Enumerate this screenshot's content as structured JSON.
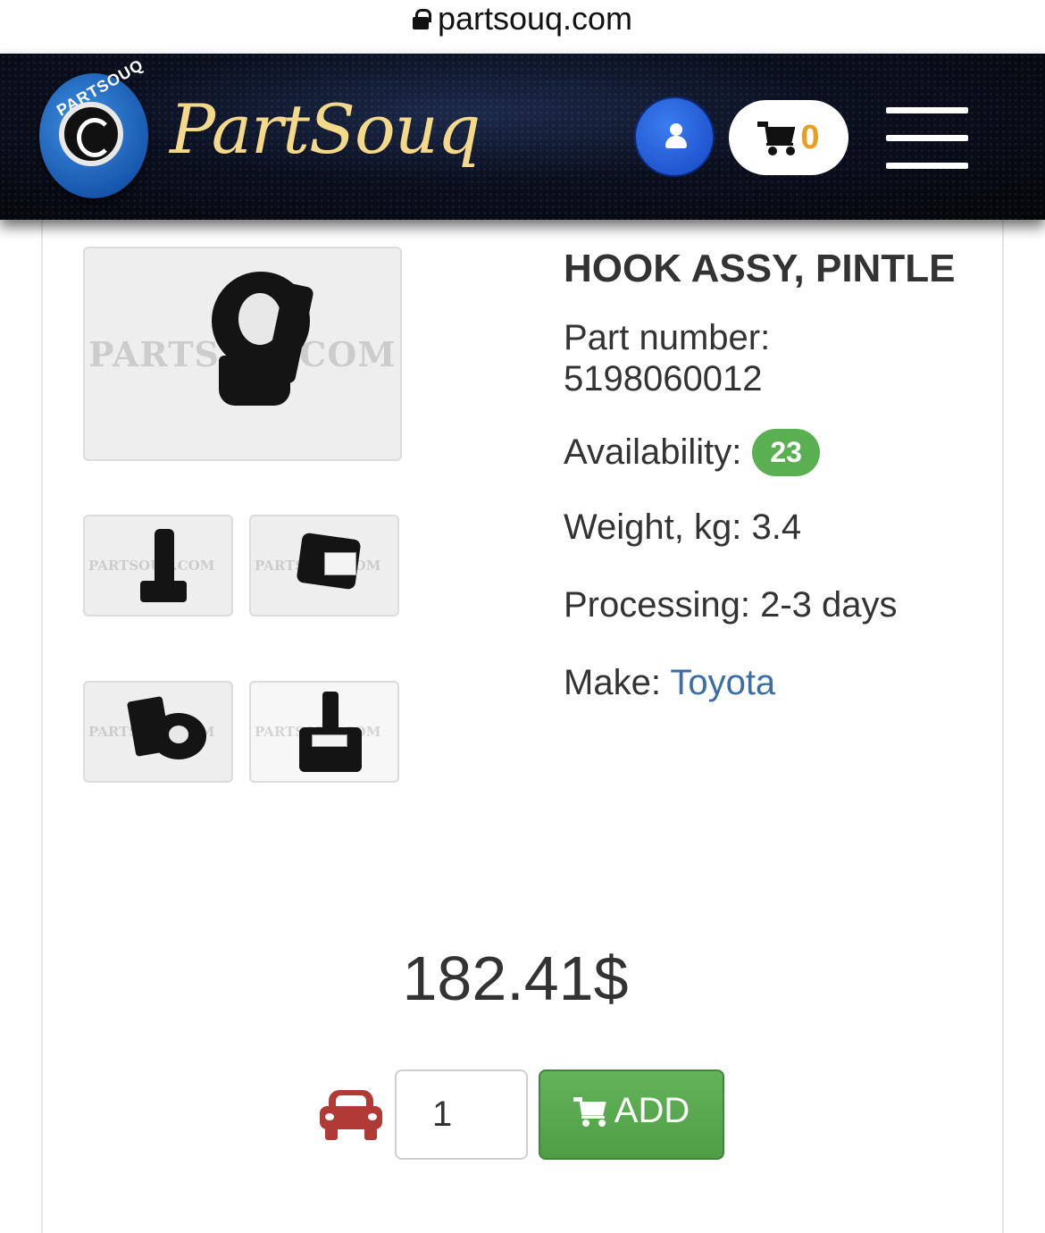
{
  "browser": {
    "url": "partsouq.com"
  },
  "header": {
    "brand_name": "PartSouq",
    "logo_text": "PARTSOUQ",
    "cart_count": "0"
  },
  "product": {
    "title": "HOOK ASSY, PINTLE",
    "part_number_label": "Part number:",
    "part_number": "5198060012",
    "availability_label": "Availability:",
    "availability_count": "23",
    "weight_label": "Weight, kg:",
    "weight_value": "3.4",
    "processing_label": "Processing:",
    "processing_value": "2-3 days",
    "make_label": "Make:",
    "make_value": "Toyota",
    "price": "182.41$",
    "watermark": "PARTSOUQ.COM"
  },
  "purchase": {
    "quantity": "1",
    "add_label": "ADD"
  },
  "colors": {
    "brand_gold": "#f5d98a",
    "cart_count": "#e8a020",
    "availability_badge": "#5aaf50",
    "make_link": "#3a6ea5",
    "add_button": "#5aaa50",
    "car_icon": "#b23a36",
    "user_button": "#2a5fd8"
  },
  "icons": [
    "lock-icon",
    "user-icon",
    "cart-icon",
    "menu-icon",
    "car-icon"
  ]
}
